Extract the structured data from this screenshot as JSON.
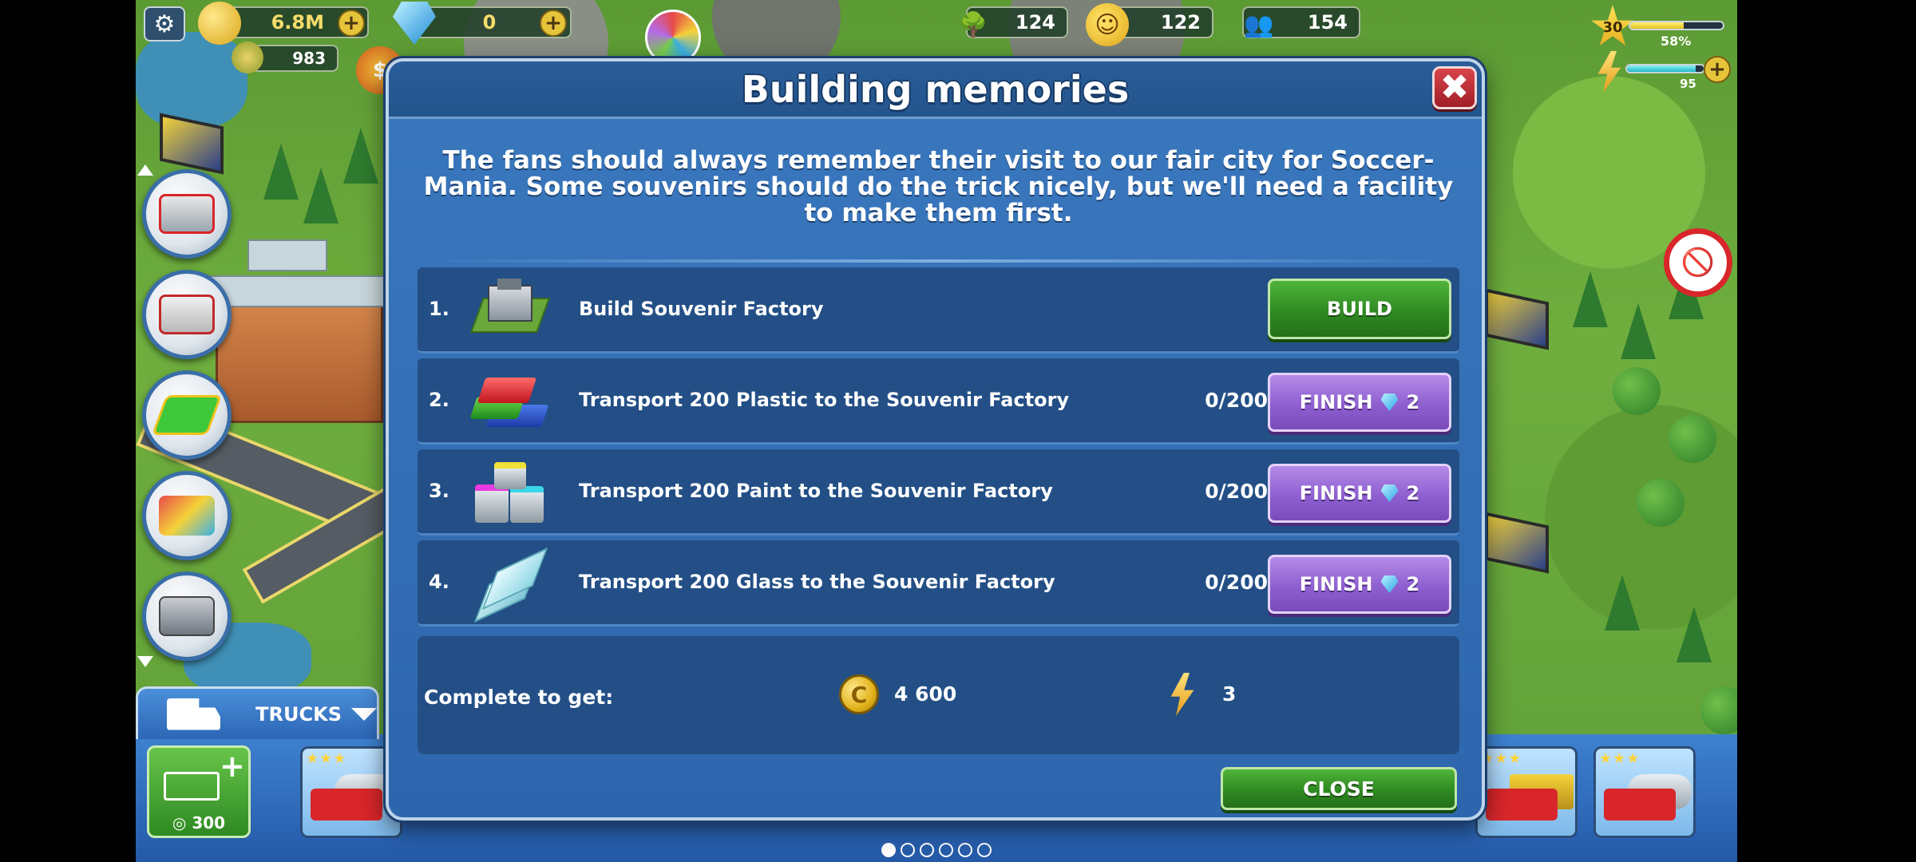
{
  "hud": {
    "coins": "6.8M",
    "gems": "0",
    "secondary_currency": "983",
    "trees": "124",
    "happiness": "122",
    "population": "154",
    "level": "30",
    "level_progress_label": "58%",
    "level_progress": 0.58,
    "energy": "95",
    "energy_progress": 0.9
  },
  "modal": {
    "title": "Building memories",
    "close_x": "✖",
    "description": "The fans should always remember their visit to our fair city for Soccer-Mania. Some souvenirs should do the trick nicely, but we'll need a facility to make them first.",
    "tasks": [
      {
        "num": "1.",
        "label": "Build Souvenir Factory",
        "progress": "",
        "button": "BUILD",
        "icon": "souvenir-factory-icon"
      },
      {
        "num": "2.",
        "label": "Transport 200 Plastic to the Souvenir Factory",
        "progress": "0/200",
        "button": "FINISH",
        "cost": "2",
        "icon": "plastic-icon"
      },
      {
        "num": "3.",
        "label": "Transport 200 Paint to the Souvenir Factory",
        "progress": "0/200",
        "button": "FINISH",
        "cost": "2",
        "icon": "paint-icon"
      },
      {
        "num": "4.",
        "label": "Transport 200 Glass to the Souvenir Factory",
        "progress": "0/200",
        "button": "FINISH",
        "cost": "2",
        "icon": "glass-icon"
      }
    ],
    "reward": {
      "label": "Complete to get:",
      "coin_symbol": "C",
      "coins": "4 600",
      "energy": "3"
    },
    "close_button": "CLOSE"
  },
  "trucks": {
    "tab_label": "TRUCKS",
    "buy_cost": "300",
    "card_stars": "★★★"
  },
  "colors": {
    "modal_blue": "#2e66ad",
    "row_blue": "#234f86",
    "build_green": "#2f8a22",
    "finish_purple": "#8e5fd0"
  }
}
